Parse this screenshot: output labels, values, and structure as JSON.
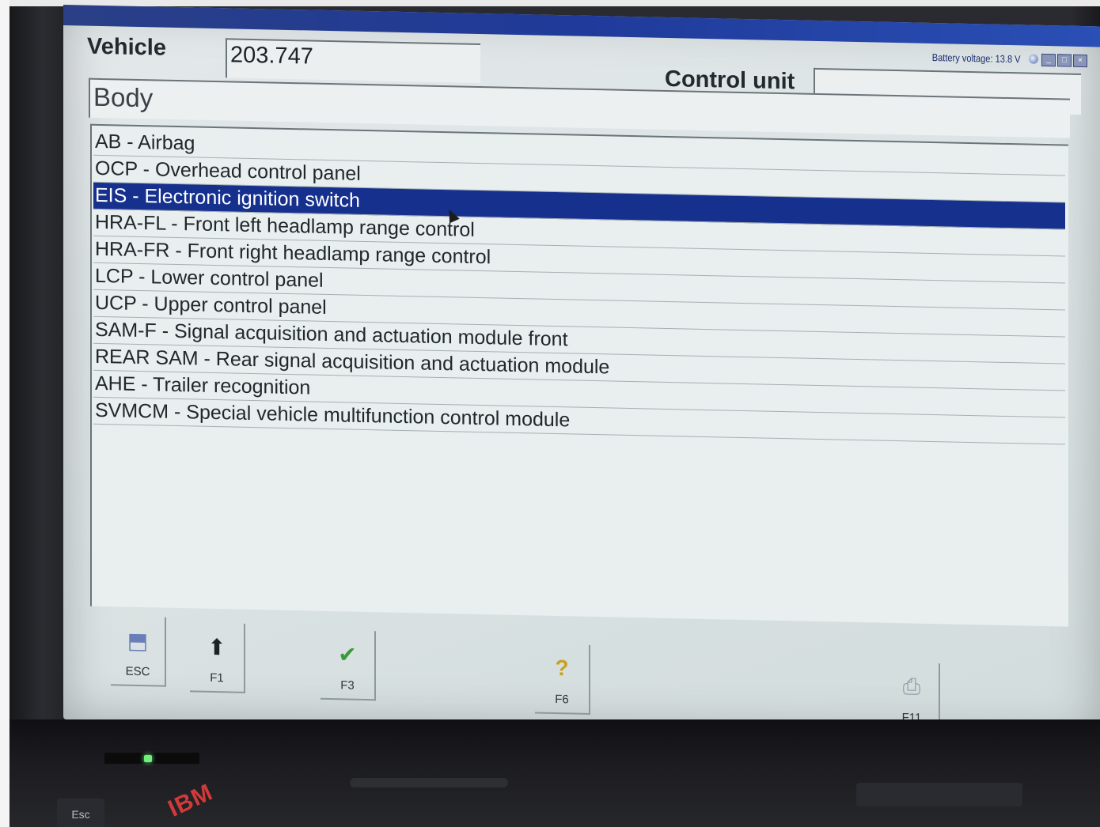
{
  "window": {
    "battery_label": "Battery voltage: 13.8 V"
  },
  "header": {
    "vehicle_label": "Vehicle",
    "vehicle_value": "203.747",
    "control_unit_label": "Control unit",
    "control_unit_value": "",
    "category": "Body"
  },
  "list": {
    "selected_index": 2,
    "items": [
      "AB - Airbag",
      "OCP - Overhead control panel",
      "EIS - Electronic ignition switch",
      "HRA-FL - Front left headlamp range control",
      "HRA-FR - Front right headlamp range control",
      "LCP - Lower control panel",
      "UCP - Upper control panel",
      "SAM-F - Signal acquisition and actuation module front",
      "REAR SAM - Rear signal acquisition and actuation module",
      "AHE - Trailer recognition",
      "SVMCM - Special vehicle multifunction control module"
    ]
  },
  "function_keys": [
    {
      "label": "ESC",
      "icon": "exit-door-icon"
    },
    {
      "label": "F1",
      "icon": "up-arrow-icon"
    },
    {
      "label": "F3",
      "icon": "checkmark-icon"
    },
    {
      "label": "F6",
      "icon": "help-question-icon"
    },
    {
      "label": "F11",
      "icon": "print-icon"
    }
  ],
  "laptop": {
    "logo": "IBM",
    "esc_key": "Esc"
  },
  "colors": {
    "selection": "#16308e",
    "titlebar": "#1f3a9a",
    "screen_bg": "#e3e8ea"
  }
}
